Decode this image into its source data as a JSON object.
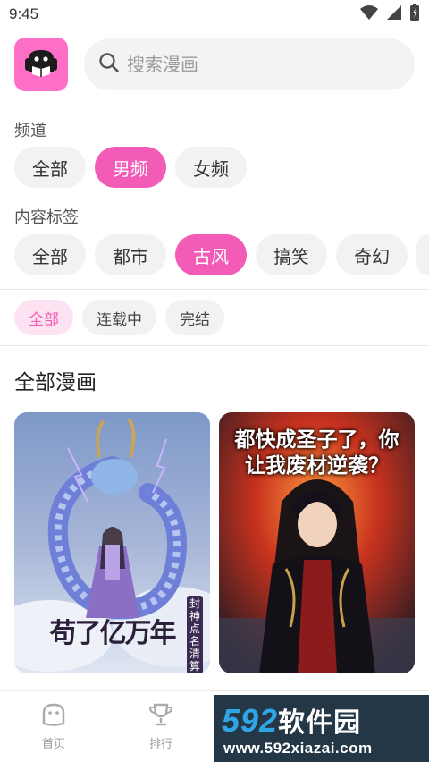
{
  "status_bar": {
    "time": "9:45"
  },
  "search": {
    "placeholder": "搜索漫画"
  },
  "channel": {
    "label": "频道",
    "options": [
      "全部",
      "男频",
      "女频"
    ],
    "selected": "男频"
  },
  "tags": {
    "label": "内容标签",
    "options": [
      "全部",
      "都市",
      "古风",
      "搞笑",
      "奇幻"
    ],
    "selected": "古风"
  },
  "status_filter": {
    "options": [
      "全部",
      "连载中",
      "完结"
    ],
    "selected": "全部"
  },
  "list": {
    "title": "全部漫画",
    "comics": [
      {
        "cover_title": "苟了亿万年",
        "cover_subtitle": "封神点名清算"
      },
      {
        "cover_title": "都快成圣子了，你让我废材逆袭？"
      }
    ]
  },
  "bottom_nav": {
    "items": [
      {
        "label": "首页",
        "icon": "home-icon"
      },
      {
        "label": "排行",
        "icon": "trophy-icon"
      }
    ]
  },
  "watermark": {
    "brand_num": "592",
    "brand_text": "软件园",
    "url": "www.592xiazai.com"
  },
  "colors": {
    "accent": "#f25bb6",
    "logo_bg": "#ff6ec7"
  }
}
